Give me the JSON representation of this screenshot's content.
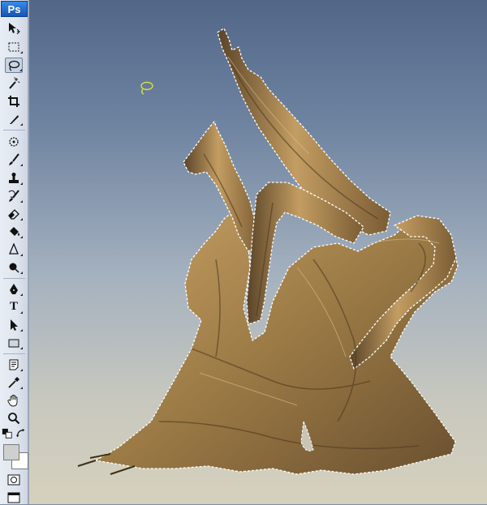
{
  "app": {
    "logo_text": "Ps",
    "active_tool": "lasso"
  },
  "toolbar": {
    "tools": [
      {
        "name": "move-tool",
        "icon": "move-icon"
      },
      {
        "name": "marquee-tool",
        "icon": "marquee-icon"
      },
      {
        "name": "lasso-tool",
        "icon": "lasso-icon"
      },
      {
        "name": "magic-wand-tool",
        "icon": "magic-wand-icon"
      },
      {
        "name": "crop-tool",
        "icon": "crop-icon"
      },
      {
        "name": "slice-tool",
        "icon": "slice-icon"
      },
      {
        "name": "healing-brush-tool",
        "icon": "healing-icon"
      },
      {
        "name": "brush-tool",
        "icon": "brush-icon"
      },
      {
        "name": "clone-stamp-tool",
        "icon": "stamp-icon"
      },
      {
        "name": "history-brush-tool",
        "icon": "history-brush-icon"
      },
      {
        "name": "eraser-tool",
        "icon": "eraser-icon"
      },
      {
        "name": "paint-bucket-tool",
        "icon": "bucket-icon"
      },
      {
        "name": "blur-tool",
        "icon": "blur-icon"
      },
      {
        "name": "dodge-tool",
        "icon": "dodge-icon"
      },
      {
        "name": "pen-tool",
        "icon": "pen-icon"
      },
      {
        "name": "type-tool",
        "icon": "type-icon",
        "glyph": "T"
      },
      {
        "name": "path-selection-tool",
        "icon": "arrow-icon"
      },
      {
        "name": "shape-tool",
        "icon": "rectangle-icon"
      },
      {
        "name": "notes-tool",
        "icon": "notes-icon"
      },
      {
        "name": "eyedropper-tool",
        "icon": "eyedropper-icon"
      },
      {
        "name": "hand-tool",
        "icon": "hand-icon"
      },
      {
        "name": "zoom-tool",
        "icon": "zoom-icon"
      }
    ],
    "colors": {
      "foreground": "#cfcfcf",
      "background": "#ffffff"
    }
  },
  "canvas": {
    "colors": {
      "sky_top": "#526788",
      "sky_bottom": "#d6d1bd",
      "trunk": "#9b7a45",
      "trunk_highlight": "#c9a266",
      "trunk_shadow": "#4e3a20",
      "selection_outline": "#ffffff",
      "lasso_cursor": "#d8e23a"
    }
  }
}
